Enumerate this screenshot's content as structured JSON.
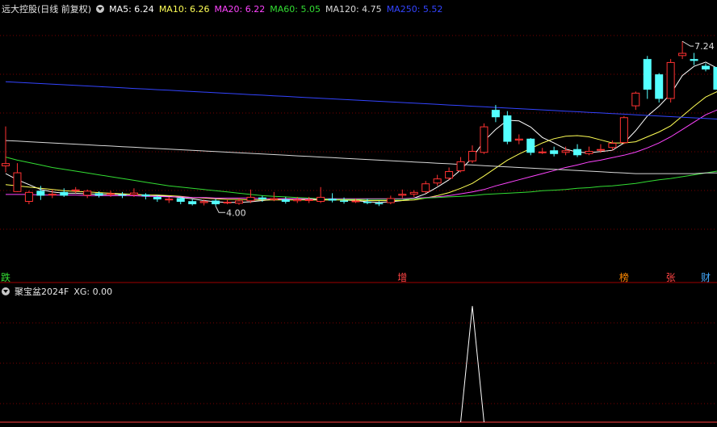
{
  "header": {
    "title": "远大控股(日线 前复权)",
    "ma": [
      {
        "label": "MA5: 6.24",
        "color": "#ffffff"
      },
      {
        "label": "MA10: 6.26",
        "color": "#ffff55"
      },
      {
        "label": "MA20: 6.22",
        "color": "#ff44ff"
      },
      {
        "label": "MA60: 5.05",
        "color": "#33dd33"
      },
      {
        "label": "MA120: 4.75",
        "color": "#d8d8d8"
      },
      {
        "label": "MA250: 5.52",
        "color": "#3344ff"
      }
    ]
  },
  "sub_header": {
    "title": "聚宝盆2024F",
    "value": "XG: 0.00"
  },
  "colors": {
    "up": "#ff3232",
    "down": "#54ffff",
    "grid": "#7a0000",
    "bg": "#000000"
  },
  "annotations": {
    "high_label": "7.24",
    "low_label": "4.00",
    "signals": [
      {
        "text": "跌",
        "color": "#33dd33",
        "index": 0
      },
      {
        "text": "增",
        "color": "#ff4444",
        "index": 34
      },
      {
        "text": "榜",
        "color": "#ff8800",
        "index": 53
      },
      {
        "text": "张",
        "color": "#ff4444",
        "index": 57
      },
      {
        "text": "财",
        "color": "#44aaff",
        "index": 60
      }
    ]
  },
  "chart_data": [
    {
      "type": "candlestick",
      "title": "远大控股(日线 前复权)",
      "ylim": [
        3.5,
        7.65
      ],
      "candles": [
        [
          5.2,
          5.25,
          5.85,
          5.1
        ],
        [
          4.78,
          5.1,
          5.25,
          4.78
        ],
        [
          4.62,
          4.78,
          4.8,
          4.58
        ],
        [
          4.8,
          4.72,
          4.88,
          4.65
        ],
        [
          4.75,
          4.75,
          4.82,
          4.68
        ],
        [
          4.78,
          4.72,
          4.84,
          4.7
        ],
        [
          4.8,
          4.82,
          4.86,
          4.76
        ],
        [
          4.72,
          4.8,
          4.82,
          4.68
        ],
        [
          4.76,
          4.72,
          4.79,
          4.69
        ],
        [
          4.74,
          4.76,
          4.8,
          4.7
        ],
        [
          4.74,
          4.72,
          4.78,
          4.68
        ],
        [
          4.73,
          4.77,
          4.84,
          4.7
        ],
        [
          4.74,
          4.71,
          4.76,
          4.66
        ],
        [
          4.7,
          4.66,
          4.73,
          4.62
        ],
        [
          4.65,
          4.67,
          4.7,
          4.6
        ],
        [
          4.68,
          4.62,
          4.7,
          4.58
        ],
        [
          4.63,
          4.58,
          4.66,
          4.56
        ],
        [
          4.6,
          4.63,
          4.66,
          4.56
        ],
        [
          4.64,
          4.58,
          4.67,
          4.55
        ],
        [
          4.6,
          4.62,
          4.66,
          4.58
        ],
        [
          4.59,
          4.64,
          4.68,
          4.57
        ],
        [
          4.63,
          4.7,
          4.82,
          4.6
        ],
        [
          4.69,
          4.66,
          4.72,
          4.62
        ],
        [
          4.65,
          4.68,
          4.78,
          4.63
        ],
        [
          4.66,
          4.62,
          4.7,
          4.59
        ],
        [
          4.63,
          4.66,
          4.7,
          4.6
        ],
        [
          4.64,
          4.66,
          4.7,
          4.6
        ],
        [
          4.62,
          4.7,
          4.86,
          4.6
        ],
        [
          4.67,
          4.64,
          4.76,
          4.61
        ],
        [
          4.64,
          4.62,
          4.69,
          4.59
        ],
        [
          4.62,
          4.64,
          4.67,
          4.6
        ],
        [
          4.62,
          4.6,
          4.67,
          4.58
        ],
        [
          4.6,
          4.58,
          4.63,
          4.55
        ],
        [
          4.6,
          4.68,
          4.72,
          4.58
        ],
        [
          4.72,
          4.75,
          4.82,
          4.68
        ],
        [
          4.74,
          4.78,
          4.81,
          4.7
        ],
        [
          4.78,
          4.92,
          4.96,
          4.76
        ],
        [
          4.92,
          5.0,
          5.06,
          4.88
        ],
        [
          5.0,
          5.12,
          5.18,
          4.98
        ],
        [
          5.12,
          5.28,
          5.35,
          5.1
        ],
        [
          5.28,
          5.45,
          5.54,
          5.25
        ],
        [
          5.42,
          5.85,
          5.9,
          5.4
        ],
        [
          6.12,
          6.0,
          6.2,
          5.92
        ],
        [
          6.03,
          5.6,
          6.1,
          5.56
        ],
        [
          5.62,
          5.65,
          5.72,
          5.56
        ],
        [
          5.65,
          5.42,
          5.66,
          5.38
        ],
        [
          5.42,
          5.44,
          5.5,
          5.4
        ],
        [
          5.46,
          5.4,
          5.52,
          5.36
        ],
        [
          5.42,
          5.46,
          5.52,
          5.38
        ],
        [
          5.48,
          5.38,
          5.56,
          5.35
        ],
        [
          5.4,
          5.45,
          5.52,
          5.38
        ],
        [
          5.46,
          5.48,
          5.56,
          5.42
        ],
        [
          5.5,
          5.58,
          5.62,
          5.46
        ],
        [
          5.58,
          6.0,
          6.02,
          5.56
        ],
        [
          6.18,
          6.4,
          6.42,
          6.12
        ],
        [
          6.95,
          6.45,
          7.0,
          6.3
        ],
        [
          6.7,
          6.3,
          6.72,
          6.24
        ],
        [
          6.3,
          6.9,
          6.95,
          6.24
        ],
        [
          7.0,
          7.05,
          7.24,
          6.95
        ],
        [
          6.95,
          6.92,
          7.05,
          6.85
        ],
        [
          6.84,
          6.78,
          6.88,
          6.75
        ],
        [
          6.82,
          6.45,
          6.85,
          6.4
        ]
      ],
      "ma_lines": [
        {
          "name": "MA5",
          "color": "#ffffff",
          "values": [
            5.08,
            4.98,
            4.9,
            4.82,
            4.78,
            4.76,
            4.76,
            4.75,
            4.74,
            4.74,
            4.74,
            4.74,
            4.73,
            4.72,
            4.71,
            4.69,
            4.67,
            4.64,
            4.62,
            4.61,
            4.61,
            4.62,
            4.64,
            4.66,
            4.67,
            4.67,
            4.66,
            4.66,
            4.66,
            4.65,
            4.64,
            4.62,
            4.61,
            4.62,
            4.64,
            4.68,
            4.75,
            4.86,
            4.98,
            5.14,
            5.34,
            5.61,
            5.8,
            5.95,
            5.94,
            5.84,
            5.67,
            5.58,
            5.48,
            5.43,
            5.42,
            5.44,
            5.46,
            5.58,
            5.78,
            6.02,
            6.18,
            6.38,
            6.68,
            6.83,
            6.9,
            6.8
          ]
        },
        {
          "name": "MA10",
          "color": "#ffff55",
          "values": [
            4.9,
            4.88,
            4.86,
            4.84,
            4.82,
            4.8,
            4.79,
            4.78,
            4.77,
            4.76,
            4.75,
            4.74,
            4.73,
            4.73,
            4.72,
            4.71,
            4.69,
            4.68,
            4.67,
            4.66,
            4.66,
            4.65,
            4.65,
            4.65,
            4.65,
            4.65,
            4.65,
            4.65,
            4.65,
            4.65,
            4.65,
            4.64,
            4.64,
            4.64,
            4.64,
            4.65,
            4.68,
            4.72,
            4.77,
            4.84,
            4.92,
            5.04,
            5.17,
            5.3,
            5.4,
            5.49,
            5.58,
            5.65,
            5.69,
            5.7,
            5.68,
            5.63,
            5.58,
            5.58,
            5.6,
            5.68,
            5.76,
            5.86,
            6.02,
            6.18,
            6.33,
            6.42
          ]
        },
        {
          "name": "MA20",
          "color": "#ff44ff",
          "values": [
            4.74,
            4.74,
            4.74,
            4.73,
            4.73,
            4.73,
            4.73,
            4.72,
            4.72,
            4.72,
            4.72,
            4.72,
            4.71,
            4.71,
            4.7,
            4.7,
            4.69,
            4.69,
            4.68,
            4.68,
            4.68,
            4.68,
            4.67,
            4.67,
            4.67,
            4.67,
            4.67,
            4.67,
            4.67,
            4.67,
            4.67,
            4.67,
            4.67,
            4.67,
            4.67,
            4.68,
            4.69,
            4.7,
            4.72,
            4.75,
            4.78,
            4.82,
            4.88,
            4.93,
            4.98,
            5.03,
            5.08,
            5.13,
            5.18,
            5.22,
            5.27,
            5.3,
            5.34,
            5.38,
            5.43,
            5.5,
            5.58,
            5.68,
            5.8,
            5.92,
            6.04,
            6.12
          ]
        },
        {
          "name": "MA60",
          "color": "#33dd33",
          "values": [
            5.35,
            5.3,
            5.26,
            5.22,
            5.18,
            5.15,
            5.12,
            5.09,
            5.06,
            5.03,
            5.0,
            4.97,
            4.94,
            4.91,
            4.88,
            4.86,
            4.84,
            4.82,
            4.8,
            4.78,
            4.76,
            4.74,
            4.72,
            4.71,
            4.7,
            4.69,
            4.68,
            4.67,
            4.66,
            4.66,
            4.66,
            4.66,
            4.66,
            4.66,
            4.66,
            4.67,
            4.68,
            4.69,
            4.7,
            4.71,
            4.72,
            4.74,
            4.75,
            4.76,
            4.77,
            4.78,
            4.8,
            4.81,
            4.82,
            4.84,
            4.85,
            4.87,
            4.88,
            4.9,
            4.92,
            4.95,
            4.98,
            5.0,
            5.03,
            5.06,
            5.09,
            5.12
          ]
        },
        {
          "name": "MA120",
          "color": "#d8d8d8",
          "values": [
            5.62,
            5.61,
            5.6,
            5.59,
            5.58,
            5.57,
            5.56,
            5.55,
            5.54,
            5.53,
            5.52,
            5.51,
            5.5,
            5.49,
            5.48,
            5.47,
            5.46,
            5.45,
            5.44,
            5.43,
            5.42,
            5.41,
            5.4,
            5.39,
            5.38,
            5.37,
            5.36,
            5.35,
            5.34,
            5.33,
            5.32,
            5.31,
            5.3,
            5.29,
            5.28,
            5.27,
            5.26,
            5.25,
            5.24,
            5.23,
            5.22,
            5.21,
            5.2,
            5.19,
            5.18,
            5.17,
            5.16,
            5.15,
            5.14,
            5.13,
            5.12,
            5.11,
            5.1,
            5.09,
            5.08,
            5.08,
            5.08,
            5.08,
            5.08,
            5.08,
            5.09,
            5.09
          ]
        },
        {
          "name": "MA250",
          "color": "#3344ff",
          "values": [
            6.58,
            6.57,
            6.56,
            6.55,
            6.54,
            6.53,
            6.52,
            6.51,
            6.5,
            6.49,
            6.48,
            6.47,
            6.46,
            6.45,
            6.44,
            6.43,
            6.42,
            6.41,
            6.4,
            6.39,
            6.38,
            6.37,
            6.36,
            6.35,
            6.34,
            6.33,
            6.32,
            6.31,
            6.3,
            6.29,
            6.28,
            6.27,
            6.26,
            6.25,
            6.24,
            6.23,
            6.22,
            6.21,
            6.2,
            6.19,
            6.18,
            6.17,
            6.16,
            6.15,
            6.14,
            6.13,
            6.12,
            6.11,
            6.1,
            6.09,
            6.08,
            6.07,
            6.06,
            6.05,
            6.04,
            6.03,
            6.02,
            6.01,
            6.0,
            5.99,
            5.98,
            5.97
          ]
        }
      ]
    },
    {
      "type": "line",
      "title": "聚宝盆2024F",
      "series": [
        {
          "name": "XG",
          "color": "#ffffff",
          "values": [
            0,
            0,
            0,
            0,
            0,
            0,
            0,
            0,
            0,
            0,
            0,
            0,
            0,
            0,
            0,
            0,
            0,
            0,
            0,
            0,
            0,
            0,
            0,
            0,
            0,
            0,
            0,
            0,
            0,
            0,
            0,
            0,
            0,
            0,
            0,
            0,
            0,
            0,
            0,
            0,
            1,
            0,
            0,
            0,
            0,
            0,
            0,
            0,
            0,
            0,
            0,
            0,
            0,
            0,
            0,
            0,
            0,
            0,
            0,
            0,
            0,
            0
          ]
        }
      ],
      "ylim": [
        0,
        1.05
      ]
    }
  ]
}
